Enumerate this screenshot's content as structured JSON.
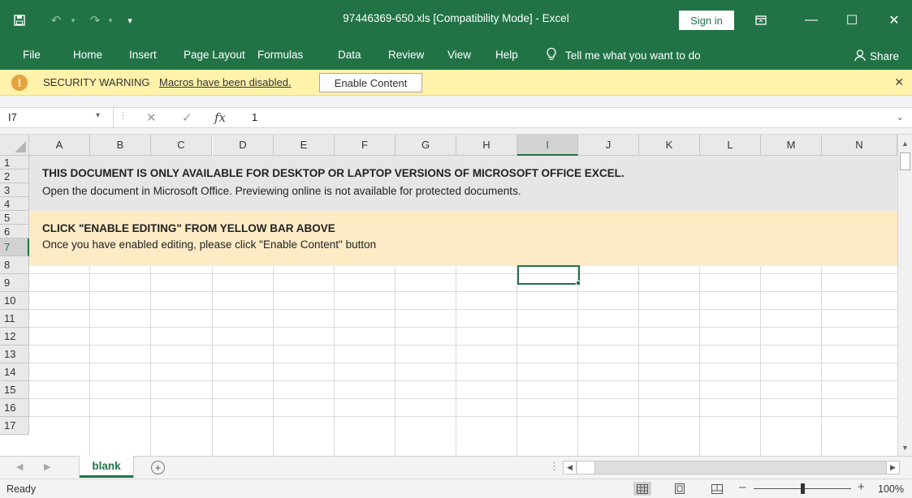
{
  "window": {
    "title": "97446369-650.xls  [Compatibility Mode]  -  Excel",
    "sign_in": "Sign in",
    "minimize": "—",
    "maximize": "☐",
    "close": "✕"
  },
  "quick_access": {
    "save_icon": "save-icon",
    "undo_icon": "undo-icon",
    "redo_icon": "redo-icon",
    "customize_icon": "customize-quick-access-icon"
  },
  "ribbon_tabs": [
    "File",
    "Home",
    "Insert",
    "Page Layout",
    "Formulas",
    "Data",
    "Review",
    "View",
    "Help"
  ],
  "tell_me": "Tell me what you want to do",
  "share": "Share",
  "security_bar": {
    "label": "SECURITY WARNING",
    "message": "Macros have been disabled.",
    "button": "Enable Content",
    "close": "✕"
  },
  "formula_bar": {
    "name_box": "I7",
    "cancel": "✕",
    "enter": "✓",
    "fx": "fx",
    "value": "1"
  },
  "columns": [
    "A",
    "B",
    "C",
    "D",
    "E",
    "F",
    "G",
    "H",
    "I",
    "J",
    "K",
    "L",
    "M",
    "N"
  ],
  "rows": [
    "1",
    "2",
    "3",
    "4",
    "5",
    "6",
    "7",
    "8",
    "9",
    "10",
    "11",
    "12",
    "13",
    "14",
    "15",
    "16",
    "17"
  ],
  "selected_cell": "I7",
  "content": {
    "notice_title": "THIS DOCUMENT IS ONLY AVAILABLE FOR DESKTOP OR LAPTOP VERSIONS OF MICROSOFT OFFICE EXCEL.",
    "notice_body": "Open the document in Microsoft Office. Previewing online is not available for protected documents.",
    "instruction_title": "CLICK \"ENABLE EDITING\" FROM YELLOW BAR ABOVE",
    "instruction_body": "Once you have enabled editing, please click \"Enable Content\" button"
  },
  "sheet_tabs": [
    "blank"
  ],
  "add_sheet": "+",
  "status": {
    "ready": "Ready",
    "zoom": "100%",
    "zoom_minus": "–",
    "zoom_plus": "+"
  },
  "colors": {
    "excel_green": "#217346",
    "warning_bar": "#fff2ab",
    "instruction_band": "#fdebc6",
    "notice_band": "#e6e6e6"
  }
}
